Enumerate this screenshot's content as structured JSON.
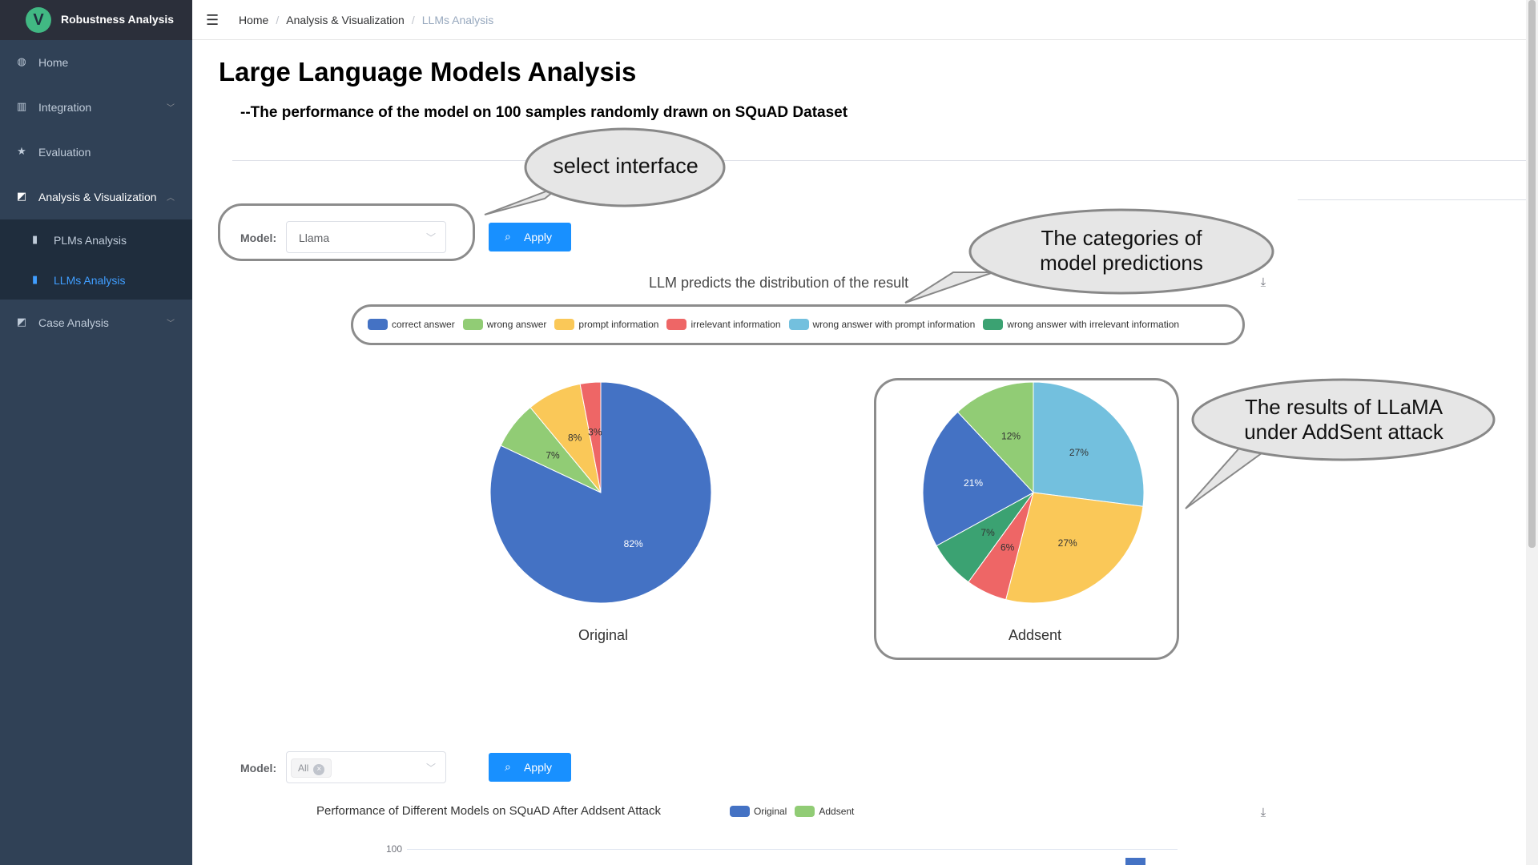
{
  "sidebar": {
    "logo_letter": "V",
    "title": "Robustness Analysis",
    "items": [
      {
        "label": "Home",
        "icon": "dashboard-icon"
      },
      {
        "label": "Integration",
        "icon": "bar-chart-icon"
      },
      {
        "label": "Evaluation",
        "icon": "star-icon"
      },
      {
        "label": "Analysis & Visualization",
        "icon": "chart-icon"
      },
      {
        "label": "Case Analysis",
        "icon": "chart-icon"
      }
    ],
    "subitems": [
      {
        "label": "PLMs Analysis",
        "icon": "book-icon"
      },
      {
        "label": "LLMs Analysis",
        "icon": "book-icon",
        "active": true
      }
    ]
  },
  "breadcrumb": [
    "Home",
    "Analysis & Visualization",
    "LLMs Analysis"
  ],
  "page": {
    "title": "Large Language Models Analysis",
    "subtitle": "--The performance of the model on 100 samples randomly drawn on SQuAD Dataset"
  },
  "form1": {
    "model_label": "Model:",
    "model_value": "Llama",
    "apply_label": "Apply"
  },
  "form2": {
    "model_label": "Model:",
    "tag_value": "All",
    "apply_label": "Apply"
  },
  "callouts": {
    "select": "select interface",
    "categories_line1": "The categories of",
    "categories_line2": "model predictions",
    "results_line1": "The results of LLaMA",
    "results_line2": "under AddSent attack"
  },
  "chart_data": [
    {
      "type": "pie",
      "title": "LLM predicts the distribution of the result",
      "legend": [
        {
          "name": "correct answer",
          "color": "#4472c4"
        },
        {
          "name": "wrong answer",
          "color": "#91cc75"
        },
        {
          "name": "prompt information",
          "color": "#fac858"
        },
        {
          "name": "irrelevant information",
          "color": "#ee6666"
        },
        {
          "name": "wrong answer with prompt information",
          "color": "#73c0de"
        },
        {
          "name": "wrong answer with irrelevant information",
          "color": "#3ba272"
        }
      ],
      "pies": [
        {
          "caption": "Original",
          "slices": [
            {
              "name": "correct answer",
              "value": 82,
              "label": "82%"
            },
            {
              "name": "wrong answer",
              "value": 7,
              "label": "7%"
            },
            {
              "name": "prompt information",
              "value": 8,
              "label": "8%"
            },
            {
              "name": "irrelevant information",
              "value": 3,
              "label": "3%"
            }
          ]
        },
        {
          "caption": "Addsent",
          "slices": [
            {
              "name": "wrong answer with prompt information",
              "value": 27,
              "label": "27%"
            },
            {
              "name": "prompt information",
              "value": 27,
              "label": "27%"
            },
            {
              "name": "irrelevant information",
              "value": 6,
              "label": "6%"
            },
            {
              "name": "wrong answer with irrelevant information",
              "value": 7,
              "label": "7%"
            },
            {
              "name": "correct answer",
              "value": 21,
              "label": "21%"
            },
            {
              "name": "wrong answer",
              "value": 12,
              "label": "12%"
            }
          ]
        }
      ]
    },
    {
      "type": "bar",
      "title": "Performance of Different Models on SQuAD After Addsent Attack",
      "series": [
        {
          "name": "Original",
          "color": "#4472c4"
        },
        {
          "name": "Addsent",
          "color": "#91cc75"
        }
      ],
      "y_tick_visible": "100"
    }
  ]
}
